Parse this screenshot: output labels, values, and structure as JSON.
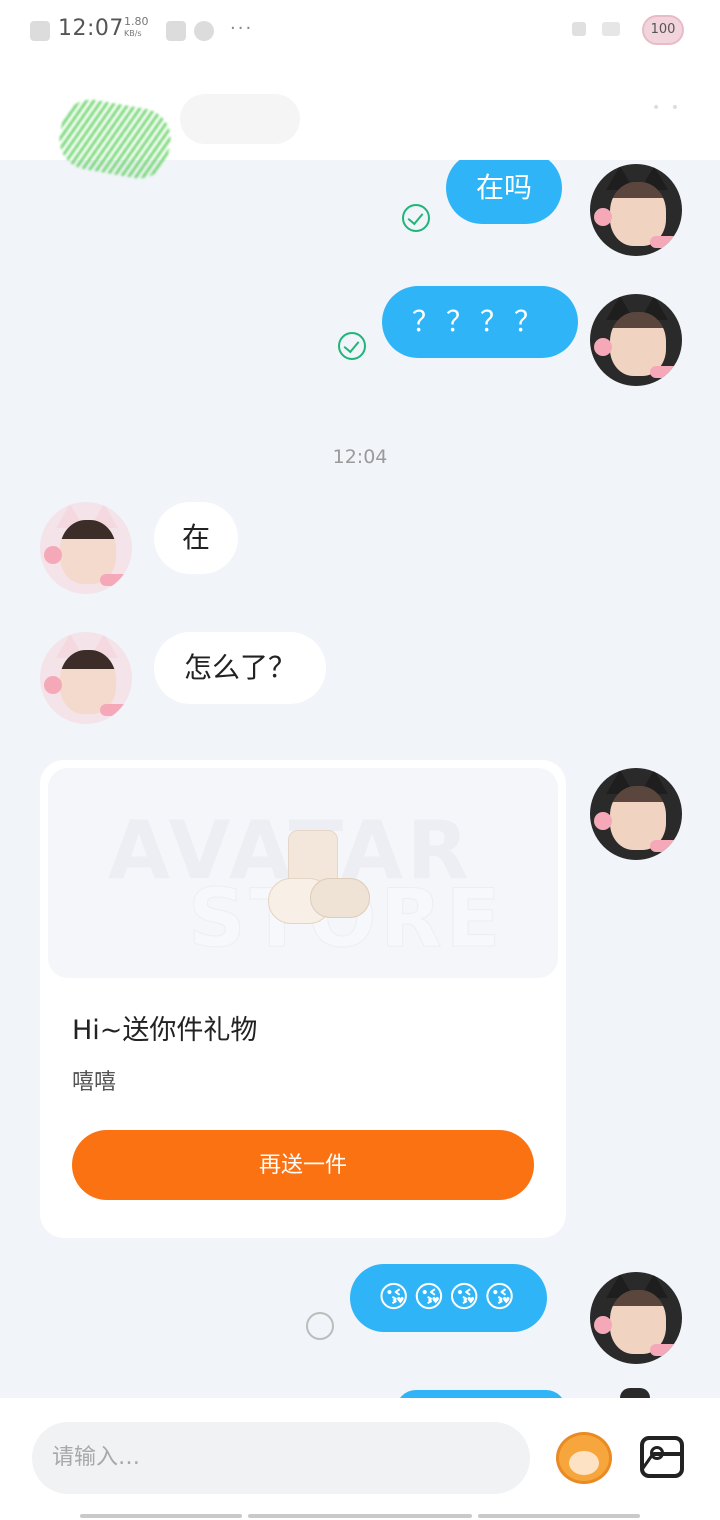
{
  "status_bar": {
    "time": "12:07",
    "network_speed_value": "1.80",
    "network_speed_unit": "KB/s",
    "more_indicator": "···",
    "battery_level": "100"
  },
  "messages": {
    "m1": {
      "direction": "outgoing",
      "text": "在吗",
      "status": "read"
    },
    "m2": {
      "direction": "outgoing",
      "text": "？？？？",
      "status": "read"
    },
    "time_divider": "12:04",
    "m3": {
      "direction": "incoming",
      "text": "在"
    },
    "m4": {
      "direction": "incoming",
      "text": "怎么了？"
    },
    "gift": {
      "image_watermark_line1": "AVATAR",
      "image_watermark_line2": "STORE",
      "title": "Hi~送你件礼物",
      "subtitle": "嘻嘻",
      "button_label": "再送一件"
    },
    "m5": {
      "direction": "outgoing",
      "text": "😘😘😘😘",
      "status": "pending"
    }
  },
  "composer": {
    "placeholder": "请输入…"
  },
  "colors": {
    "outgoing_bubble": "#2fb5f7",
    "incoming_bubble": "#ffffff",
    "read_check": "#1fb57a",
    "gift_button": "#fb7213",
    "chat_background": "#f1f4f9"
  },
  "icons": {
    "sticker": "monkey-sticker-icon",
    "image": "image-icon",
    "read_receipt": "check-circle-icon",
    "pending": "pending-circle-icon"
  }
}
